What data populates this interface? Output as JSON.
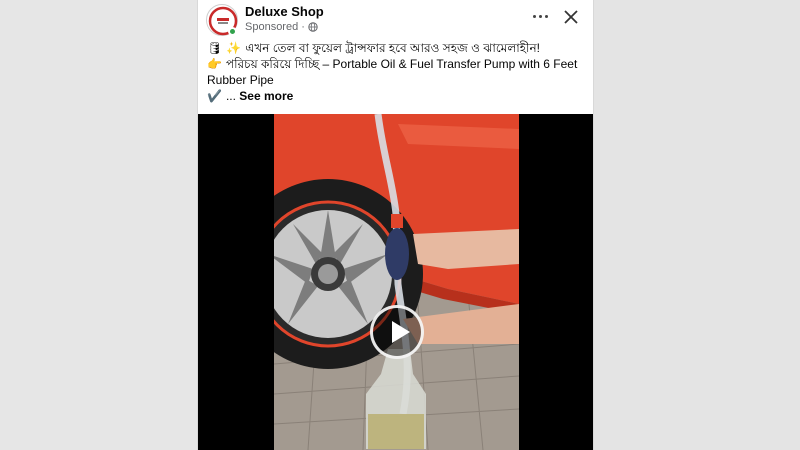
{
  "post": {
    "page_name": "Deluxe Shop",
    "sponsored_label": "Sponsored",
    "separator": "·",
    "text_line1": "এখন তেল বা ফুয়েল ট্রান্সফার হবে আরও সহজ ও ঝামেলাহীন!",
    "text_line2": "পরিচয় করিয়ে দিচ্ছি – Portable Oil & Fuel Transfer Pump with 6 Feet",
    "text_line3": "Rubber Pipe",
    "text_line4_prefix": "... ",
    "see_more": "See more",
    "emoji_line1a": "🛢",
    "emoji_line1b": "✨",
    "emoji_line2": "👉",
    "emoji_line4": "✔️"
  },
  "icons": {
    "avatar": "deluxe-shop-logo",
    "more": "more-horizontal-icon",
    "close": "close-icon",
    "globe": "globe-icon",
    "play": "play-icon"
  },
  "colors": {
    "online": "#31a24c",
    "text": "#050505",
    "meta": "#65676b",
    "car": "#e0452b"
  }
}
